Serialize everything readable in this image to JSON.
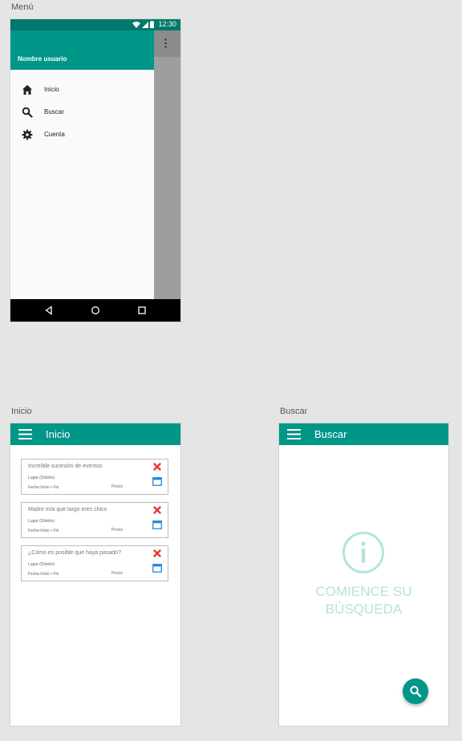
{
  "artboards": {
    "menu_label": "Menú",
    "inicio_label": "Inicio",
    "buscar_label": "Buscar"
  },
  "status_bar": {
    "time": "12:30"
  },
  "drawer": {
    "username": "Nombre usuario",
    "items": [
      {
        "label": "Inicio",
        "icon": "home-icon"
      },
      {
        "label": "Buscar",
        "icon": "search-icon"
      },
      {
        "label": "Cuenta",
        "icon": "gear-icon"
      }
    ]
  },
  "inicio": {
    "title": "Inicio",
    "cards": [
      {
        "title": "Increíble sucesión de eventos",
        "lugar": "Lugar (Distrito)",
        "fecha": "Fecha Inicio • Fin",
        "precio": "Precio"
      },
      {
        "title": "Madre mía que largo eres chico",
        "lugar": "Lugar (Distrito)",
        "fecha": "Fecha Inicio • Fin",
        "precio": "Precio"
      },
      {
        "title": "¿Cómo es posible que haya pasado?",
        "lugar": "Lugar (Distrito)",
        "fecha": "Fecha Inicio • Fin",
        "precio": "Precio"
      }
    ]
  },
  "buscar": {
    "title": "Buscar",
    "empty_line1": "COMIENCE SU",
    "empty_line2": "BÚSQUEDA"
  },
  "colors": {
    "primary": "#009688",
    "primary_dark": "#00796b",
    "delete": "#e53935",
    "calendar": "#1e88e5",
    "empty_state": "#b3e3df"
  }
}
